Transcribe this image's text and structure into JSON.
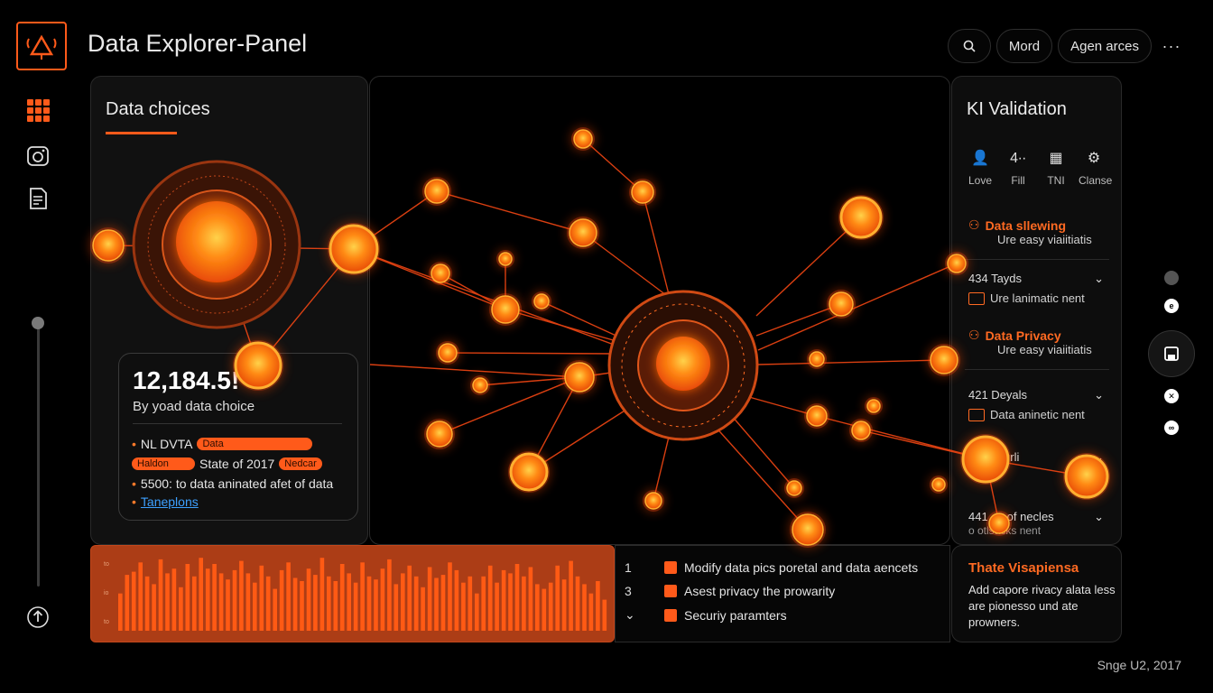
{
  "app": {
    "title": "Data Explorer-Panel"
  },
  "topbar": {
    "mode_label": "Mord",
    "agents_label": "Agen arces"
  },
  "left_panel": {
    "title": "Data choices",
    "stat_value": "12,184.5!",
    "stat_caption": "By yoad data choice",
    "line1_text": "NL DVTA",
    "line1_tag": "Data",
    "line2_tag_a": "Haldon",
    "line2_text": "State of 2017",
    "line2_tag_b": "Nedcar",
    "line3_text": "5500: to data aninated afet of data",
    "link_text": "Taneplons"
  },
  "right_panel": {
    "title": "KI Validation",
    "icons": [
      {
        "name": "person-icon",
        "glyph": "👤",
        "label": "Love"
      },
      {
        "name": "signal-icon",
        "glyph": "4∙∙",
        "label": "Fill"
      },
      {
        "name": "table-icon",
        "glyph": "▦",
        "label": "TNI"
      },
      {
        "name": "settings-icon",
        "glyph": "⚙",
        "label": "Clanse"
      }
    ],
    "items": [
      {
        "kind": "highlight",
        "title": "Data sllewing",
        "sub": "Ure easy viaiitiatis"
      },
      {
        "kind": "row",
        "title": "434 Tayds",
        "sub": "Ure lanimatic nent"
      },
      {
        "kind": "highlight",
        "title": "Data Privacy",
        "sub": "Ure easy viaiitiatis"
      },
      {
        "kind": "row",
        "title": "421 Deyals",
        "sub": "Data aninetic nent"
      },
      {
        "kind": "row",
        "title": "e ay Murli",
        "sub": ""
      },
      {
        "kind": "row",
        "title": "441 es of necles",
        "sub": "o otlsacks nent"
      }
    ]
  },
  "bar_chart": {
    "tick_labels": [
      "to",
      "io",
      "to"
    ],
    "values": [
      48,
      72,
      76,
      88,
      70,
      60,
      92,
      74,
      80,
      56,
      86,
      70,
      94,
      80,
      86,
      74,
      66,
      78,
      90,
      74,
      62,
      84,
      70,
      54,
      78,
      88,
      68,
      64,
      80,
      72,
      94,
      70,
      64,
      86,
      74,
      62,
      88,
      70,
      66,
      80,
      92,
      60,
      74,
      84,
      70,
      56,
      82,
      68,
      72,
      88,
      78,
      62,
      70,
      48,
      70,
      84,
      62,
      78,
      74,
      86,
      70,
      82,
      60,
      54,
      62,
      84,
      66,
      90,
      70,
      60,
      48,
      64,
      40
    ]
  },
  "checklist": {
    "rows": [
      {
        "num": "1",
        "text": "Modify data pics poretal and data aencets"
      },
      {
        "num": "3",
        "text": "Asest privacy the prowarity"
      },
      {
        "num": "",
        "text": "Securiy paramters"
      }
    ]
  },
  "tip": {
    "title": "Thate Visapiensa",
    "body": "Add capore rivacy alata less are pionesso und ate prowners."
  },
  "footer": {
    "text": "Snge U2, 2017"
  },
  "colors": {
    "accent": "#ff5a1a",
    "glow": "#ff7a1a",
    "background": "#000000"
  }
}
